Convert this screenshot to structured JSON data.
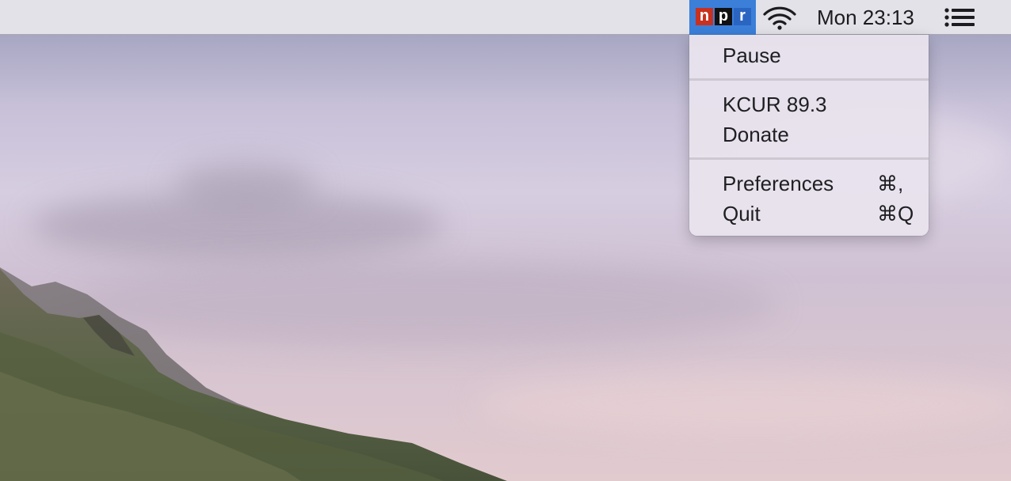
{
  "menubar": {
    "app_icon": {
      "name": "npr-icon",
      "letters": [
        "n",
        "p",
        "r"
      ]
    },
    "wifi_icon": "wifi-icon",
    "clock": "Mon 23:13",
    "notification_icon": "notification-center-icon"
  },
  "menu": {
    "items": [
      {
        "label": "Pause"
      },
      {
        "label": "KCUR 89.3"
      },
      {
        "label": "Donate"
      },
      {
        "label": "Preferences",
        "shortcut": "⌘,"
      },
      {
        "label": "Quit",
        "shortcut": "⌘Q"
      }
    ]
  },
  "colors": {
    "menubar_bg": "#e3e2e9",
    "selected_item_bg": "#3b7fd9",
    "npr_red": "#c8311f",
    "npr_black": "#111111",
    "npr_blue": "#2b65c2"
  }
}
